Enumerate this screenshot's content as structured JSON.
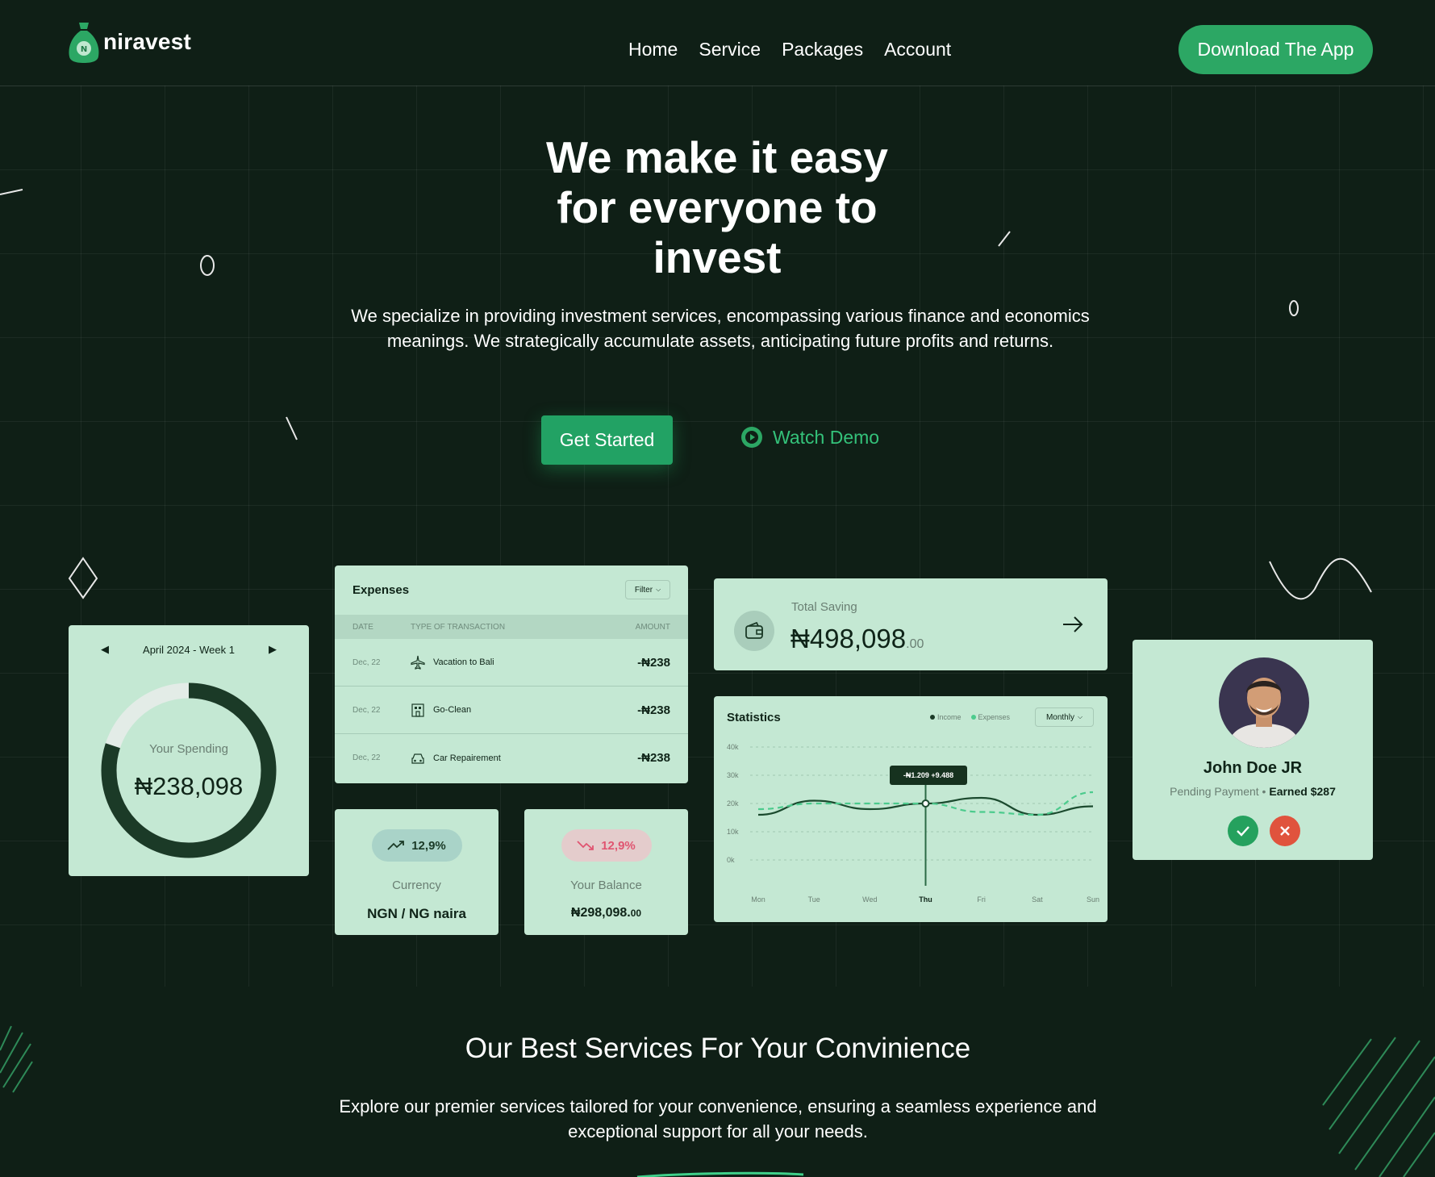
{
  "nav": {
    "brand": "niravest",
    "links": [
      "Home",
      "Service",
      "Packages",
      "Account"
    ],
    "download_label": "Download The App"
  },
  "hero": {
    "title_line1": "We make it easy",
    "title_line2": "for everyone to",
    "title_line3": "invest",
    "description": "We specialize in providing investment services, encompassing various finance and economics meanings. We strategically accumulate assets, anticipating future profits and returns.",
    "cta_primary": "Get Started",
    "cta_secondary": "Watch Demo"
  },
  "spending": {
    "period": "April 2024 - Week 1",
    "label": "Your Spending",
    "amount": "₦238,098",
    "progress": 0.8
  },
  "expenses": {
    "title": "Expenses",
    "filter": "Filter",
    "columns": [
      "DATE",
      "TYPE OF TRANSACTION",
      "AMOUNT"
    ],
    "rows": [
      {
        "date": "Dec, 22",
        "type": "Vacation to Bali",
        "amount": "-₦238",
        "icon": "airplane-icon"
      },
      {
        "date": "Dec, 22",
        "type": "Go-Clean",
        "amount": "-₦238",
        "icon": "building-icon"
      },
      {
        "date": "Dec, 22",
        "type": "Car Repairement",
        "amount": "-₦238",
        "icon": "car-icon"
      }
    ]
  },
  "currency": {
    "change": "12,9%",
    "label": "Currency",
    "value": "NGN / NG naira"
  },
  "balance": {
    "change": "12,9%",
    "label": "Your Balance",
    "value": "₦298,098.",
    "value_cents": "00"
  },
  "saving": {
    "label": "Total Saving",
    "amount": "₦498,098",
    "cents": ".00"
  },
  "statistics": {
    "title": "Statistics",
    "legend_income": "Income",
    "legend_expenses": "Expenses",
    "period": "Monthly",
    "tooltip": "-₦1.209 +9.488",
    "highlight_day": "Thu"
  },
  "chart_data": {
    "type": "line",
    "categories": [
      "Mon",
      "Tue",
      "Wed",
      "Thu",
      "Fri",
      "Sat",
      "Sun"
    ],
    "yticks": [
      "40k",
      "30k",
      "20k",
      "10k",
      "0k"
    ],
    "ylim": [
      0,
      40
    ],
    "series": [
      {
        "name": "Income",
        "values": [
          16,
          21,
          18,
          20,
          22,
          16,
          19
        ]
      },
      {
        "name": "Expenses",
        "values": [
          18,
          20,
          20,
          20,
          17,
          16,
          24
        ]
      }
    ]
  },
  "profile": {
    "name": "John Doe JR",
    "status": "Pending Payment",
    "earned": "Earned $287"
  },
  "services": {
    "title": "Our Best Services For Your Convinience",
    "description": "Explore our premier services tailored for your convenience, ensuring a seamless experience and exceptional support for all your needs."
  },
  "colors": {
    "background": "#0f1f16",
    "accent": "#2ca764",
    "card": "#c4e8d3",
    "danger": "#e0533d"
  }
}
